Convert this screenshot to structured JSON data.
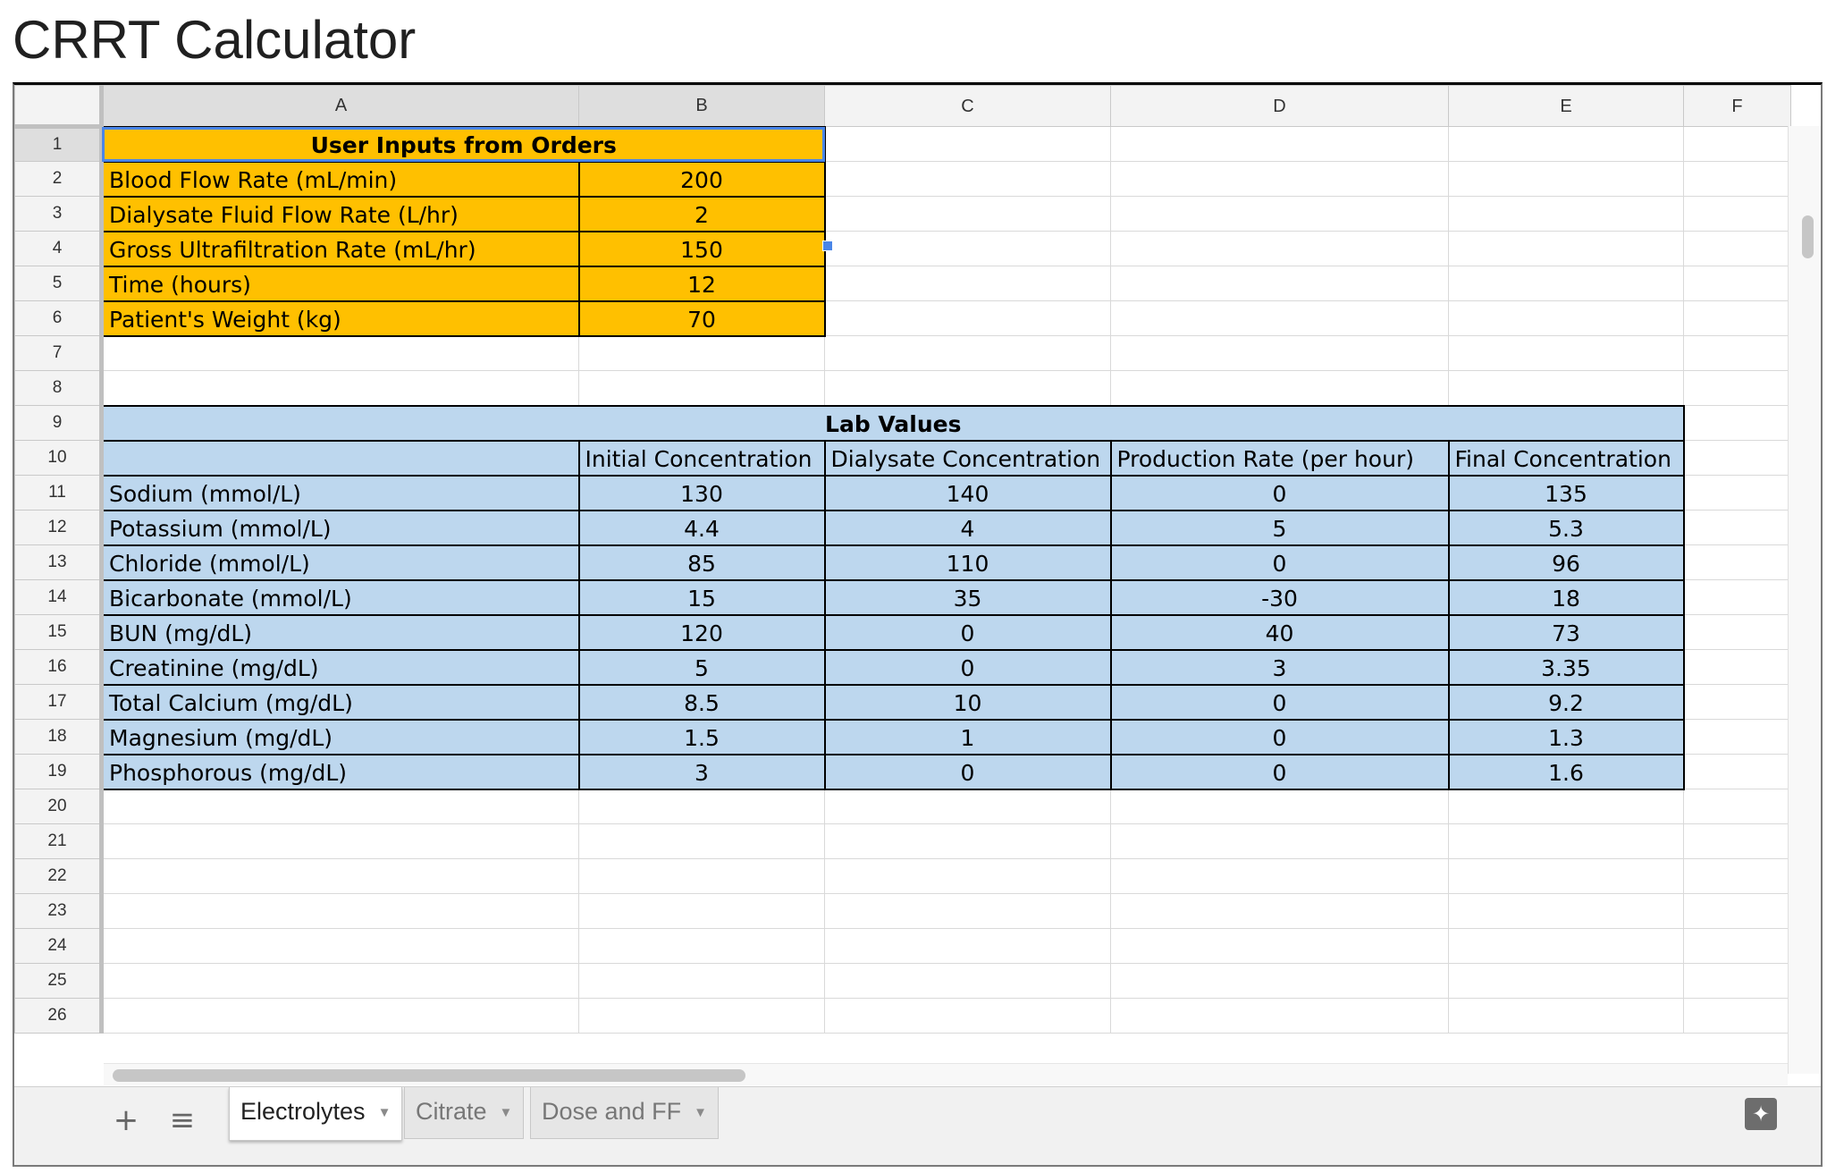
{
  "page": {
    "title": "CRRT Calculator"
  },
  "columns": [
    "A",
    "B",
    "C",
    "D",
    "E",
    "F"
  ],
  "rows": {
    "r1": "1",
    "r2": "2",
    "r3": "3",
    "r4": "4",
    "r5": "5",
    "r6": "6",
    "r7": "7",
    "r8": "8",
    "r9": "9",
    "r10": "10",
    "r11": "11",
    "r12": "12",
    "r13": "13",
    "r14": "14",
    "r15": "15",
    "r16": "16",
    "r17": "17",
    "r18": "18",
    "r19": "19",
    "r20": "20",
    "r21": "21",
    "r22": "22",
    "r23": "23",
    "r24": "24",
    "r25": "25",
    "r26": "26"
  },
  "inputs": {
    "header": "User Inputs from Orders",
    "items": [
      {
        "label": "Blood Flow Rate (mL/min)",
        "value": "200"
      },
      {
        "label": "Dialysate Fluid Flow Rate (L/hr)",
        "value": "2"
      },
      {
        "label": "Gross Ultrafiltration Rate (mL/hr)",
        "value": "150"
      },
      {
        "label": "Time (hours)",
        "value": "12"
      },
      {
        "label": "Patient's Weight (kg)",
        "value": "70"
      }
    ]
  },
  "labs": {
    "header": "Lab Values",
    "col_headers": [
      "Initial Concentration",
      "Dialysate Concentration",
      "Production Rate (per hour)",
      "Final Concentration"
    ],
    "rows": [
      {
        "name": "Sodium (mmol/L)",
        "initial": "130",
        "dialysate": "140",
        "production": "0",
        "final": "135"
      },
      {
        "name": "Potassium (mmol/L)",
        "initial": "4.4",
        "dialysate": "4",
        "production": "5",
        "final": "5.3"
      },
      {
        "name": "Chloride (mmol/L)",
        "initial": "85",
        "dialysate": "110",
        "production": "0",
        "final": "96"
      },
      {
        "name": "Bicarbonate (mmol/L)",
        "initial": "15",
        "dialysate": "35",
        "production": "-30",
        "final": "18"
      },
      {
        "name": "BUN (mg/dL)",
        "initial": "120",
        "dialysate": "0",
        "production": "40",
        "final": "73"
      },
      {
        "name": "Creatinine (mg/dL)",
        "initial": "5",
        "dialysate": "0",
        "production": "3",
        "final": "3.35"
      },
      {
        "name": "Total Calcium (mg/dL)",
        "initial": "8.5",
        "dialysate": "10",
        "production": "0",
        "final": "9.2"
      },
      {
        "name": "Magnesium (mg/dL)",
        "initial": "1.5",
        "dialysate": "1",
        "production": "0",
        "final": "1.3"
      },
      {
        "name": "Phosphorous (mg/dL)",
        "initial": "3",
        "dialysate": "0",
        "production": "0",
        "final": "1.6"
      }
    ]
  },
  "toolbar": {
    "add_icon": "+",
    "list_icon": "≡",
    "explore_icon": "✦"
  },
  "tabs": [
    {
      "label": "Electrolytes",
      "active": true
    },
    {
      "label": "Citrate",
      "active": false
    },
    {
      "label": "Dose and FF",
      "active": false
    }
  ],
  "colors": {
    "input_fill": "#ffc000",
    "lab_fill": "#bdd7ee",
    "selection": "#4a86e8"
  }
}
